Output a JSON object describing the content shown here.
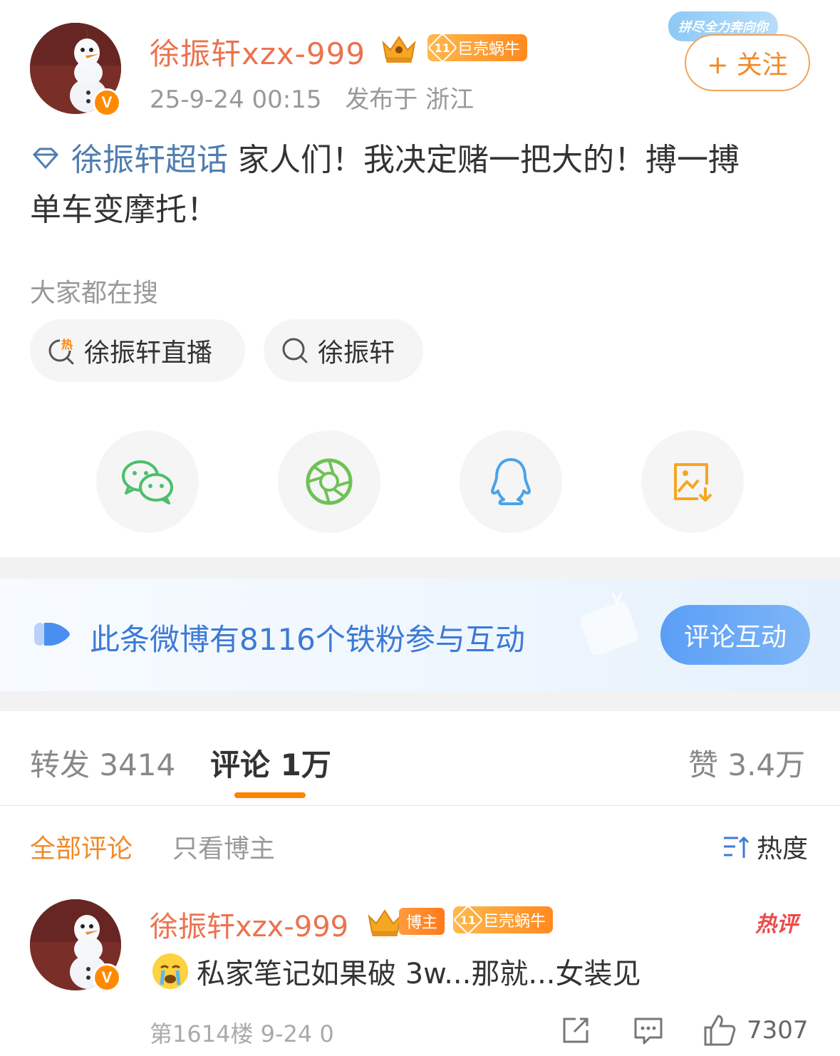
{
  "post": {
    "author": {
      "name": "徐振轩xzx-999",
      "level": "11",
      "level_title": "巨壳蜗牛",
      "verified_mark": "V"
    },
    "meta": {
      "timestamp": "25-9-24 00:15",
      "location": "发布于 浙江"
    },
    "follow_label": "+ 关注",
    "follow_deco_text": "拼尽全力奔向你",
    "topic": "徐振轩超话",
    "text_line1": "家人们！我决定赌一把大的！搏一搏",
    "text_line2": "单车变摩托！"
  },
  "search": {
    "label": "大家都在搜",
    "chips": [
      {
        "label": "徐振轩直播",
        "icon": "hot-search-icon",
        "hot_mark": "热"
      },
      {
        "label": "徐振轩",
        "icon": "search-icon"
      }
    ]
  },
  "share": {
    "items": [
      {
        "icon": "wechat-icon",
        "color": "#4cbf6b"
      },
      {
        "icon": "moments-icon",
        "color": "#6dc253"
      },
      {
        "icon": "qq-icon",
        "color": "#4aa3e8"
      },
      {
        "icon": "save-image-icon",
        "color": "#f5a623"
      }
    ]
  },
  "fans_banner": {
    "text": "此条微博有8116个铁粉参与互动",
    "button": "评论互动"
  },
  "tabs": {
    "repost": "转发 3414",
    "comments": "评论 1万",
    "likes": "赞 3.4万"
  },
  "filters": {
    "all": "全部评论",
    "author_only": "只看博主",
    "sort": "热度"
  },
  "comment": {
    "author": "徐振轩xzx-999",
    "blogger_badge": "博主",
    "level": "11",
    "level_title": "巨壳蜗牛",
    "hot_tag": "热评",
    "text": "私家笔记如果破 3w...那就...女装见",
    "floor_meta": "第1614楼 9-24 0",
    "likes": "7307"
  },
  "colors": {
    "accent_orange": "#ff8200",
    "name_orange": "#eb7350",
    "topic_blue": "#507daf",
    "fans_blue": "#3d7ad6"
  }
}
